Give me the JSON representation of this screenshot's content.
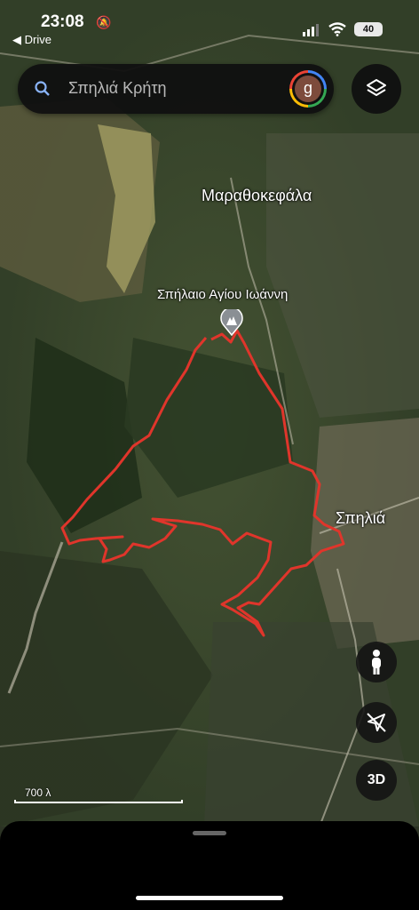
{
  "status_bar": {
    "time": "23:08",
    "back_link": "◀ Drive",
    "battery": "40"
  },
  "search": {
    "placeholder": "Σπηλιά Κρήτη",
    "avatar_letter": "g"
  },
  "map": {
    "labels": {
      "village_north": "Μαραθοκεφάλα",
      "cave": "Σπήλαιο Αγίου Ιωάννη",
      "village_east": "Σπηλιά"
    },
    "scale": "700 λ",
    "route_color": "#e0352b",
    "imagery": "satellite"
  },
  "controls": {
    "three_d": "3D"
  },
  "icons": [
    "search-icon",
    "layers-icon",
    "pegman-icon",
    "compass-icon",
    "cave-pin-icon",
    "bell-muted-icon",
    "signal-icon",
    "wifi-icon"
  ]
}
